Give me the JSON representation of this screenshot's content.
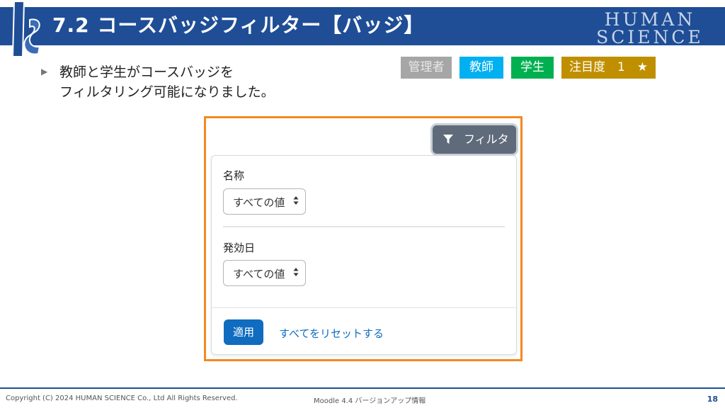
{
  "slide": {
    "title": "7.2 コースバッジフィルター【バッジ】",
    "brand_line1": "HUMAN",
    "brand_line2": "SCIENCE",
    "bullet_line1": "教師と学生がコースバッジを",
    "bullet_line2": "フィルタリング可能になりました。",
    "badges": {
      "admin": "管理者",
      "teacher": "教師",
      "student": "学生",
      "attention": "注目度　1　★"
    },
    "colors": {
      "header": "#1f4e96",
      "admin": "#a6a6a6",
      "teacher": "#00b0f0",
      "student": "#00b050",
      "attention": "#bf8f00",
      "highlight_frame": "#f4891f"
    }
  },
  "screenshot": {
    "filter_button_label": "フィルタ",
    "fields": [
      {
        "label": "名称",
        "select_value": "すべての値"
      },
      {
        "label": "発効日",
        "select_value": "すべての値"
      }
    ],
    "apply_button_label": "適用",
    "reset_link_label": "すべてをリセットする",
    "colors": {
      "primary": "#0f6cbf",
      "filter_button": "#5f6b7a"
    }
  },
  "footer": {
    "copyright": "Copyright (C) 2024 HUMAN SCIENCE Co., Ltd All Rights Reserved.",
    "center_text": "Moodle 4.4 バージョンアップ情報",
    "page_number": "18"
  }
}
